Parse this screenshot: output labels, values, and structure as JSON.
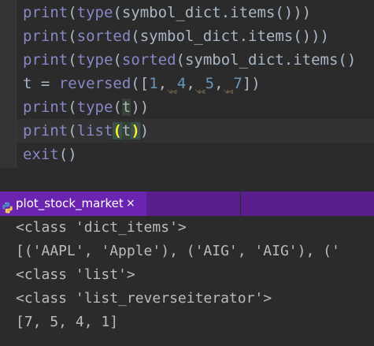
{
  "editor": {
    "lines": [
      [
        {
          "text": "print",
          "cls": "kw"
        },
        {
          "text": "(",
          "cls": ""
        },
        {
          "text": "type",
          "cls": "kw"
        },
        {
          "text": "(symbol_dict.items()))",
          "cls": ""
        }
      ],
      [
        {
          "text": "print",
          "cls": "kw"
        },
        {
          "text": "(",
          "cls": ""
        },
        {
          "text": "sorted",
          "cls": "kw"
        },
        {
          "text": "(symbol_dict.items()))",
          "cls": ""
        }
      ],
      [
        {
          "text": "print",
          "cls": "kw"
        },
        {
          "text": "(",
          "cls": ""
        },
        {
          "text": "type",
          "cls": "kw"
        },
        {
          "text": "(",
          "cls": ""
        },
        {
          "text": "sorted",
          "cls": "kw"
        },
        {
          "text": "(symbol_dict.items()",
          "cls": ""
        }
      ],
      [
        {
          "text": "t",
          "cls": ""
        },
        {
          "text": " = ",
          "cls": ""
        },
        {
          "text": "reversed",
          "cls": "kw"
        },
        {
          "text": "([",
          "cls": ""
        },
        {
          "text": "1",
          "cls": "num"
        },
        {
          "text": ",",
          "cls": ""
        },
        {
          "text": "༺",
          "cls": "hint"
        },
        {
          "text": "4",
          "cls": "num"
        },
        {
          "text": ",",
          "cls": ""
        },
        {
          "text": "༺",
          "cls": "hint"
        },
        {
          "text": "5",
          "cls": "num"
        },
        {
          "text": ",",
          "cls": ""
        },
        {
          "text": "༺",
          "cls": "hint"
        },
        {
          "text": "7",
          "cls": "num"
        },
        {
          "text": "])",
          "cls": ""
        }
      ],
      [
        {
          "text": "print",
          "cls": "kw"
        },
        {
          "text": "(",
          "cls": ""
        },
        {
          "text": "type",
          "cls": "kw"
        },
        {
          "text": "(",
          "cls": ""
        },
        {
          "text": "t",
          "cls": "var-hl"
        },
        {
          "text": "))",
          "cls": ""
        }
      ],
      [
        {
          "text": "print",
          "cls": "kw"
        },
        {
          "text": "(",
          "cls": ""
        },
        {
          "text": "list",
          "cls": "kw"
        },
        {
          "text": "(",
          "cls": "brace-match"
        },
        {
          "text": "t",
          "cls": "var-hl"
        },
        {
          "text": ")",
          "cls": "brace-match"
        },
        {
          "text": ")",
          "cls": ""
        }
      ],
      [
        {
          "text": "exit",
          "cls": "kw"
        },
        {
          "text": "()",
          "cls": ""
        }
      ]
    ],
    "current_line": 5
  },
  "run_tab": {
    "icon": "python-icon",
    "label": "plot_stock_market",
    "close": "×"
  },
  "console": {
    "lines": [
      "<class 'dict_items'>",
      "[('AAPL', 'Apple'), ('AIG', 'AIG'), ('",
      "<class 'list'>",
      "<class 'list_reverseiterator'>",
      "[7, 5, 4, 1]"
    ]
  },
  "colors": {
    "editor_bg": "#2b2b2b",
    "keyword": "#8888c6",
    "number": "#6897bb",
    "text": "#a9b7c6",
    "tab_active": "#6a24b0",
    "tab_strip": "#5a1f8c",
    "console_text": "#bbbbbb"
  }
}
